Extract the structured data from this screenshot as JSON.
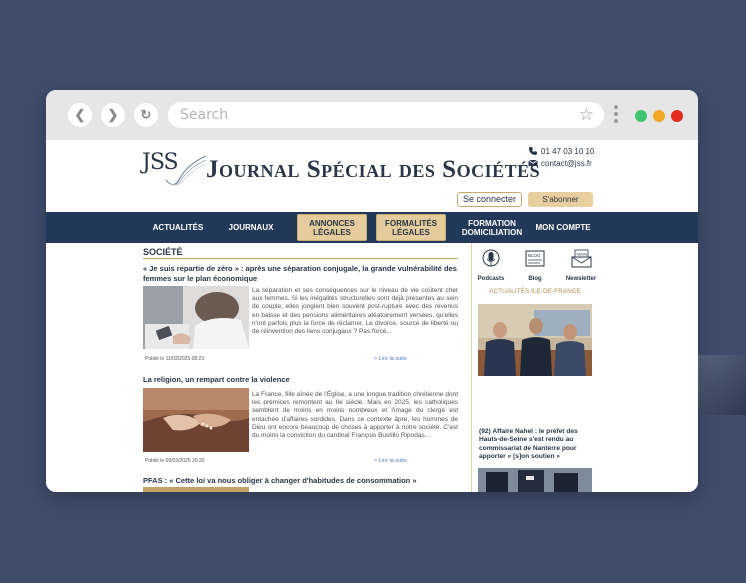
{
  "browser": {
    "search_placeholder": "Search",
    "window_dots": [
      "#3fc46f",
      "#f2a825",
      "#e32a20"
    ]
  },
  "site": {
    "logo_text": "JSS",
    "title": "Journal Spécial des Sociétés",
    "phone": "01 47 03 10 10",
    "email": "contact@jss.fr",
    "connect_label": "Se connecter",
    "subscribe_label": "S'abonner"
  },
  "menu": [
    {
      "label": "ACTUALITÉS"
    },
    {
      "label": "JOURNAUX"
    },
    {
      "label": "ANNONCES LÉGALES"
    },
    {
      "label": "FORMALITÉS LÉGALES"
    },
    {
      "label": "FORMATION DOMICILIATION"
    },
    {
      "label": "MON COMPTE"
    }
  ],
  "main": {
    "section": "SOCIÉTÉ",
    "articles": [
      {
        "title": "« Je suis repartie de zéro » : après une séparation conjugale, la grande vulnérabilité des femmes sur le plan économique",
        "excerpt": "La séparation et ses conséquences sur le niveau de vie coûtent cher aux femmes. Si les inégalités structurelles sont déjà présentes au sein de couple, elles jonglent bien souvent post-rupture avec des revenus en baisse et des pensions alimentaires aléatoirement versées, qu'elles n'ont parfois plus la force de réclamer. Le divorce, source de liberté ou de réinvention des liens conjugaux ? Pas forcé...",
        "date": "Publié le 11/03/2025 08:23",
        "more": "> Lire la suite"
      },
      {
        "title": "La religion, un rempart contre la violence",
        "excerpt": "La France, fille aînée de l'Église, a une longue tradition chrétienne dont les prémices remontent au IIe siècle. Mais en 2025, les catholiques semblent de moins en moins nombreux et l'image du clergé est entachée d'affaires sordides. Dans ce contexte âpre, les hommes de Dieu ont encore beaucoup de choses à apporter à notre société. C'est du moins la conviction du cardinal François Bustillo Ripodas...",
        "date": "Publié le 09/03/2025 20:30",
        "more": "> Lire la suite"
      },
      {
        "title": "PFAS : « Cette loi va nous obliger à changer d'habitudes de consommation »"
      }
    ]
  },
  "sidebar": {
    "icons": [
      {
        "label": "Podcasts"
      },
      {
        "label": "Blog"
      },
      {
        "label": "Newsletter"
      }
    ],
    "blog_tag": "BLOG",
    "news_tag": "NEWS",
    "heading": "ACTUALITÉS ILE-DE-FRANCE",
    "caption": "(92) Affaire Nahel : le préfet des Hauts-de-Seine s'est rendu au commissariat de Nanterre pour apporter « [s]on soutien »"
  }
}
